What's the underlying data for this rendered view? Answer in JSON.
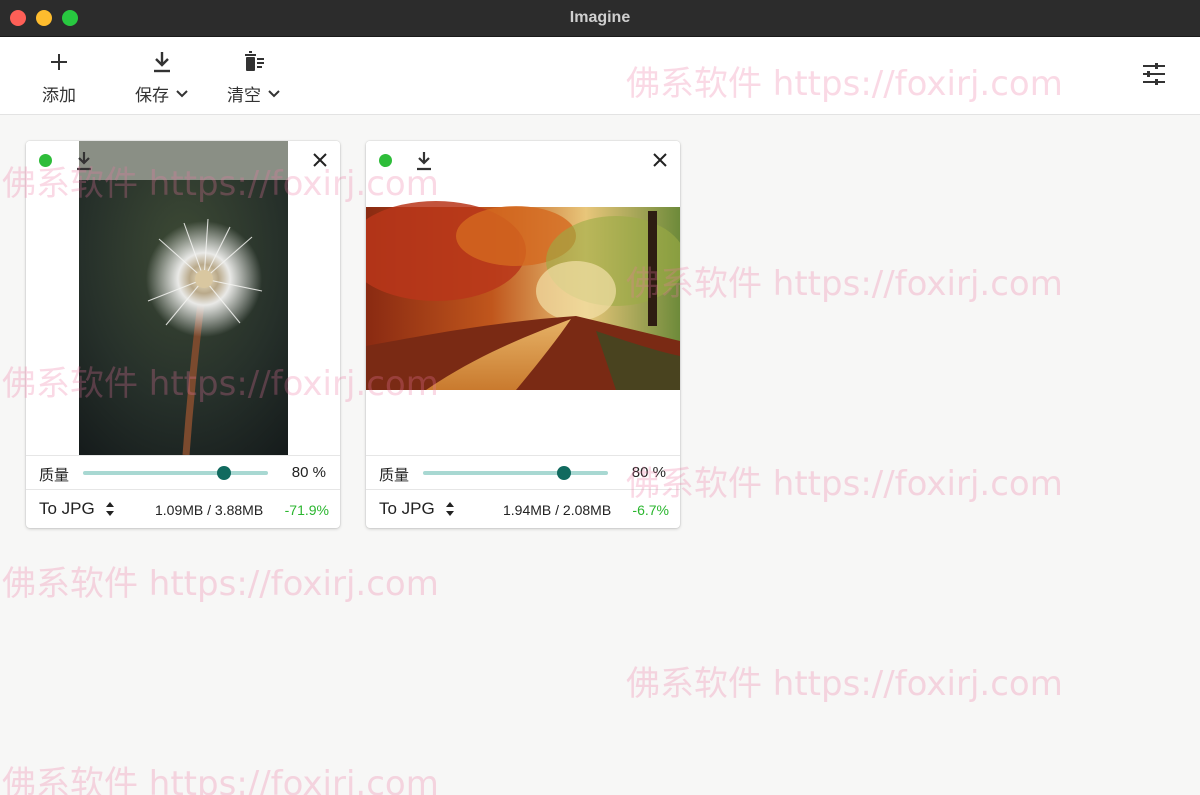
{
  "window": {
    "title": "Imagine"
  },
  "toolbar": {
    "add_label": "添加",
    "save_label": "保存",
    "clear_label": "清空"
  },
  "cards": [
    {
      "quality_label": "质量",
      "quality_value": "80 %",
      "quality_level": 0.76,
      "format_label": "To JPG",
      "sizes": "1.09MB / 3.88MB",
      "saving": "-71.9%"
    },
    {
      "quality_label": "质量",
      "quality_value": "80 %",
      "quality_level": 0.76,
      "format_label": "To JPG",
      "sizes": "1.94MB / 2.08MB",
      "saving": "-6.7%"
    }
  ],
  "watermark_text": "佛系软件 https://foxirj.com",
  "colors": {
    "accent": "#116a5f",
    "slider_track": "#a8d8d2",
    "status_ok": "#2ebd3a",
    "saving_text": "#2bb62f",
    "watermark": "#f3b6cb"
  },
  "icons": [
    "plus-icon",
    "download-icon",
    "trash-icon",
    "chevron-down-icon",
    "sliders-icon",
    "close-icon",
    "up-down-arrows-icon"
  ]
}
